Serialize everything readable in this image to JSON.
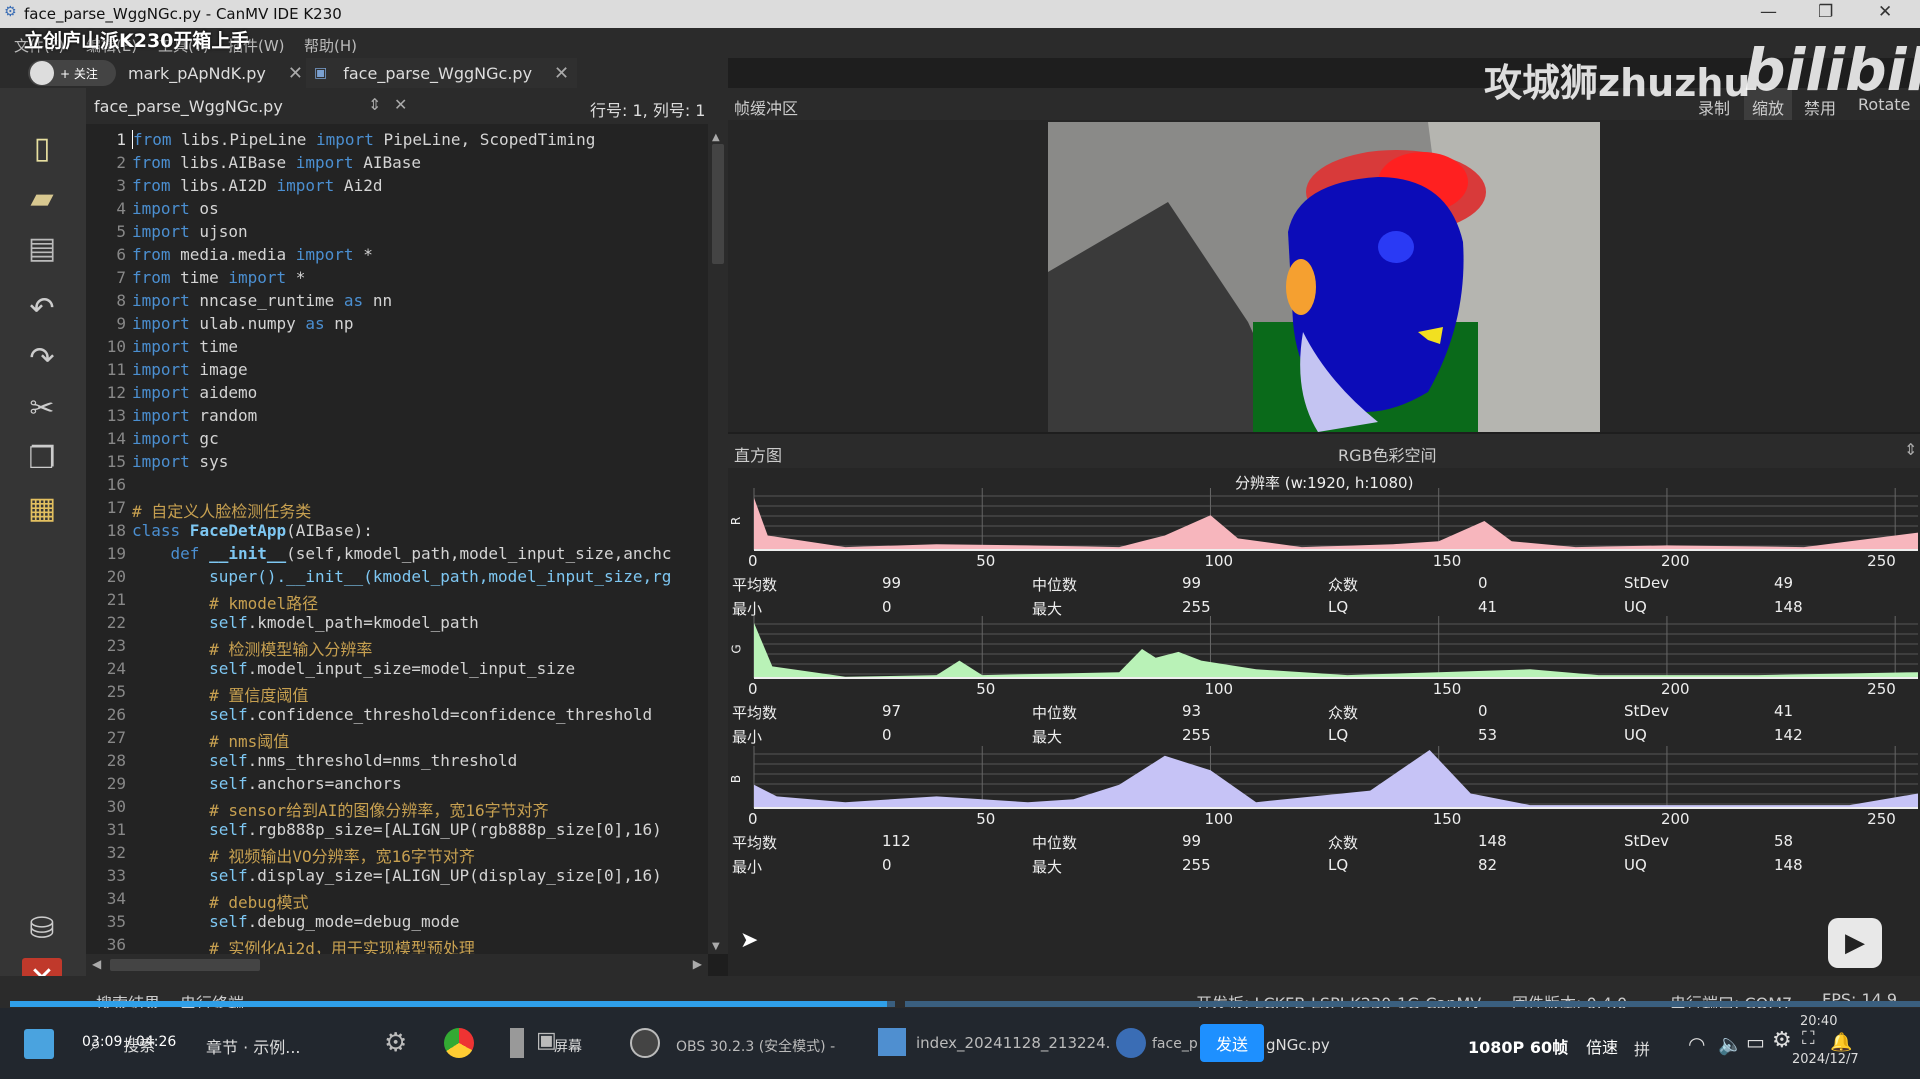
{
  "window": {
    "title": "face_parse_WggNGc.py - CanMV IDE K230",
    "overlay_title": "立创庐山派K230开箱上手",
    "follow": "+ 关注"
  },
  "menu": [
    "文件(F)",
    "编辑(E)",
    "工具(T)",
    "插件(W)",
    "帮助(H)"
  ],
  "tabs": [
    {
      "label": "mark_pApNdK.py"
    },
    {
      "label": "face_parse_WggNGc.py"
    }
  ],
  "editor": {
    "filename": "face_parse_WggNGc.py",
    "position": "行号: 1, 列号: 1"
  },
  "code_lines": [
    "1",
    "2",
    "3",
    "4",
    "5",
    "6",
    "7",
    "8",
    "9",
    "10",
    "11",
    "12",
    "13",
    "14",
    "15",
    "16",
    "17",
    "18",
    "19",
    "20",
    "21",
    "22",
    "23",
    "24",
    "25",
    "26",
    "27",
    "28",
    "29",
    "30",
    "31",
    "32",
    "33",
    "34",
    "35",
    "36"
  ],
  "code": {
    "l1a": "from",
    "l1b": " libs.PipeLine ",
    "l1c": "import",
    "l1d": " PipeLine, ScopedTiming",
    "l2a": "from",
    "l2b": " libs.AIBase ",
    "l2c": "import",
    "l2d": " AIBase",
    "l3a": "from",
    "l3b": " libs.AI2D ",
    "l3c": "import",
    "l3d": " Ai2d",
    "l4a": "import",
    "l4b": " os",
    "l5a": "import",
    "l5b": " ujson",
    "l6a": "from",
    "l6b": " media.media ",
    "l6c": "import",
    "l6d": " *",
    "l7a": "from",
    "l7b": " time ",
    "l7c": "import",
    "l7d": " *",
    "l8a": "import",
    "l8b": " nncase_runtime ",
    "l8c": "as",
    "l8d": " nn",
    "l9a": "import",
    "l9b": " ulab.numpy ",
    "l9c": "as",
    "l9d": " np",
    "l10a": "import",
    "l10b": " time",
    "l11a": "import",
    "l11b": " image",
    "l12a": "import",
    "l12b": " aidemo",
    "l13a": "import",
    "l13b": " random",
    "l14a": "import",
    "l14b": " gc",
    "l15a": "import",
    "l15b": " sys",
    "l17": "# 自定义人脸检测任务类",
    "l18a": "class",
    "l18b": " FaceDetApp",
    "l18c": "(AIBase):",
    "l19a": "    def",
    "l19b": " __init__",
    "l19c": "(self,kmodel_path,model_input_size,anchc",
    "l20": "        super().__init__(kmodel_path,model_input_size,rg",
    "l21": "        # kmodel路径",
    "l22a": "        self",
    "l22b": ".kmodel_path=kmodel_path",
    "l23": "        # 检测模型输入分辨率",
    "l24a": "        self",
    "l24b": ".model_input_size=model_input_size",
    "l25": "        # 置信度阈值",
    "l26a": "        self",
    "l26b": ".confidence_threshold=confidence_threshold",
    "l27": "        # nms阈值",
    "l28a": "        self",
    "l28b": ".nms_threshold=nms_threshold",
    "l29a": "        self",
    "l29b": ".anchors=anchors",
    "l30": "        # sensor给到AI的图像分辨率，宽16字节对齐",
    "l31a": "        self",
    "l31b": ".rgb888p_size=[ALIGN_UP(rgb888p_size[0],16)",
    "l32": "        # 视频输出VO分辨率，宽16字节对齐",
    "l33a": "        self",
    "l33b": ".display_size=[ALIGN_UP(display_size[0],16)",
    "l34": "        # debug模式",
    "l35a": "        self",
    "l35b": ".debug_mode=debug_mode",
    "l36": "        # 实例化Ai2d，用于实现模型预处理"
  },
  "framebuffer": {
    "title": "帧缓冲区",
    "buttons": [
      "录制",
      "缩放",
      "禁用",
      "Rotate"
    ]
  },
  "histogram": {
    "title": "直方图",
    "colorspace": "RGB色彩空间",
    "resolution": "分辨率 (w:1920, h:1080)",
    "ticks": [
      "0",
      "50",
      "100",
      "150",
      "200",
      "250"
    ],
    "channels": [
      {
        "label": "R",
        "color": "#f7b6bd",
        "stats": {
          "avg_l": "平均数",
          "avg": "99",
          "med_l": "中位数",
          "med": "99",
          "mode_l": "众数",
          "mode": "0",
          "std_l": "StDev",
          "std": "49",
          "min_l": "最小",
          "min": "0",
          "max_l": "最大",
          "max": "255",
          "lq_l": "LQ",
          "lq": "41",
          "uq_l": "UQ",
          "uq": "148"
        }
      },
      {
        "label": "G",
        "color": "#b9f2b7",
        "stats": {
          "avg_l": "平均数",
          "avg": "97",
          "med_l": "中位数",
          "med": "93",
          "mode_l": "众数",
          "mode": "0",
          "std_l": "StDev",
          "std": "41",
          "min_l": "最小",
          "min": "0",
          "max_l": "最大",
          "max": "255",
          "lq_l": "LQ",
          "lq": "53",
          "uq_l": "UQ",
          "uq": "142"
        }
      },
      {
        "label": "B",
        "color": "#c6c3f6",
        "stats": {
          "avg_l": "平均数",
          "avg": "112",
          "med_l": "中位数",
          "med": "99",
          "mode_l": "众数",
          "mode": "148",
          "std_l": "StDev",
          "std": "58",
          "min_l": "最小",
          "min": "0",
          "max_l": "最大",
          "max": "255",
          "lq_l": "LQ",
          "lq": "82",
          "uq_l": "UQ",
          "uq": "148"
        }
      }
    ]
  },
  "status": {
    "search": "搜索结果",
    "serial": "串行终端",
    "board": "开发板: LCKFB-LSPI-K230-1G-CanMV",
    "firmware": "固件版本: 0.4.0",
    "port": "串行端口: COM7",
    "fps": "FPS: 14.9"
  },
  "watermark": {
    "author": "攻城狮zhuzhu",
    "logo": "bilibili"
  },
  "taskbar": {
    "time_played": "03:09 / 04:26",
    "search": "搜索",
    "chapter": "章节 · 示例...",
    "screen": "屏幕",
    "obs": "OBS 30.2.3 (安全模式) -",
    "index": "index_20241128_213224.",
    "face": "face_p",
    "send": "发送",
    "face_tail": "gNGc.py",
    "quality": "1080P 60帧",
    "speed": "倍速",
    "ime": "拼",
    "clock": "20:40",
    "date": "2024/12/7"
  }
}
